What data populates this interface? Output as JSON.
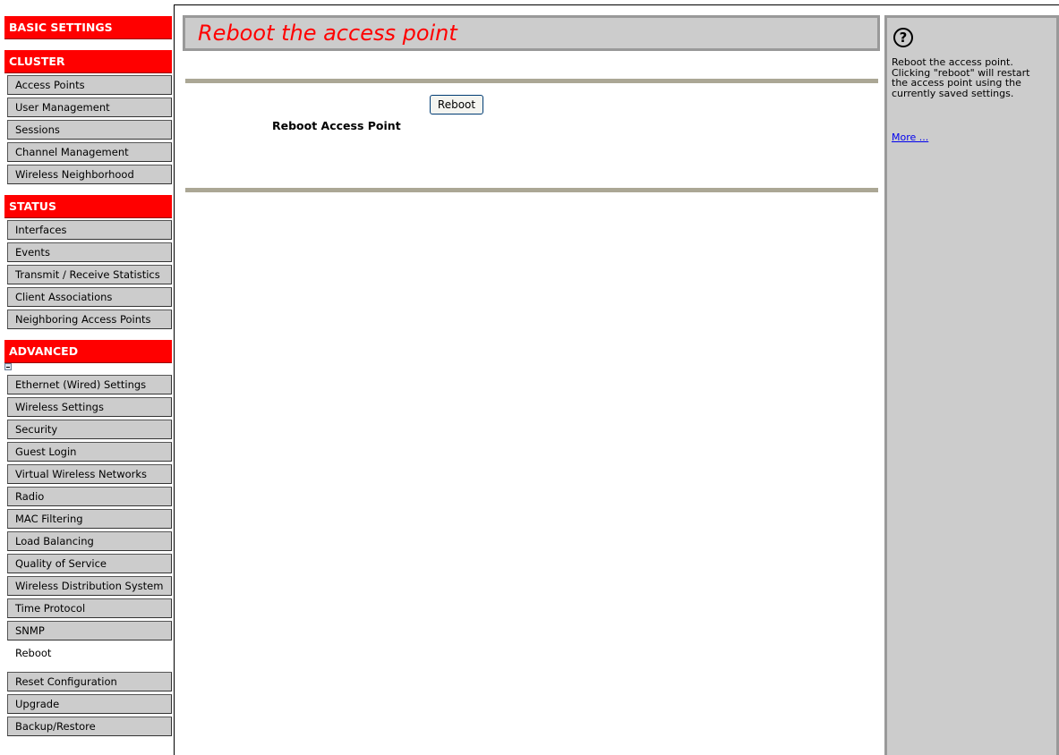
{
  "nav": {
    "basic_settings": "BASIC SETTINGS",
    "cluster": {
      "header": "CLUSTER",
      "items": [
        "Access Points",
        "User Management",
        "Sessions",
        "Channel Management",
        "Wireless Neighborhood"
      ]
    },
    "status": {
      "header": "STATUS",
      "items": [
        "Interfaces",
        "Events",
        "Transmit / Receive Statistics",
        "Client Associations",
        "Neighboring Access Points"
      ]
    },
    "advanced": {
      "header": "ADVANCED",
      "items": [
        "Ethernet (Wired) Settings",
        "Wireless Settings",
        "Security",
        "Guest Login",
        "Virtual Wireless Networks",
        "Radio",
        "MAC Filtering",
        "Load Balancing",
        "Quality of Service",
        "Wireless Distribution System",
        "Time Protocol",
        "SNMP",
        "Reboot",
        "Reset Configuration",
        "Upgrade",
        "Backup/Restore"
      ],
      "active": "Reboot"
    }
  },
  "main": {
    "title": "Reboot the access point",
    "reboot_button": "Reboot",
    "reboot_label": "Reboot Access Point"
  },
  "help": {
    "icon": "question-mark-icon",
    "text": "Reboot the access point. Clicking \"reboot\" will restart the access point using the currently saved settings.",
    "more_link": "More ..."
  },
  "colors": {
    "header_red": "#ff0000",
    "nav_item_bg": "#cccccc",
    "title_text": "#ff0000",
    "separator": "#aba795"
  }
}
